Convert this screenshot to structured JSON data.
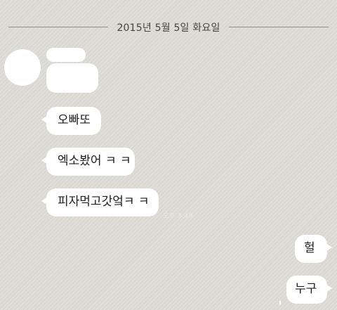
{
  "date_divider": "2015년 5월 5일 화요일",
  "messages": [
    {
      "direction": "incoming",
      "text": "오빠또"
    },
    {
      "direction": "incoming",
      "text": "엑소봤어 ㅋ ㅋ"
    },
    {
      "direction": "incoming",
      "text": "피자먹고갓엌ㅋ ㅋ"
    },
    {
      "direction": "outgoing",
      "text": "헐"
    },
    {
      "direction": "outgoing",
      "text": "누구"
    }
  ],
  "timestamp": "오후 3:49",
  "colors": {
    "background": "#dedcd6",
    "bubble": "#ffffff",
    "text": "#1e1e1e"
  }
}
